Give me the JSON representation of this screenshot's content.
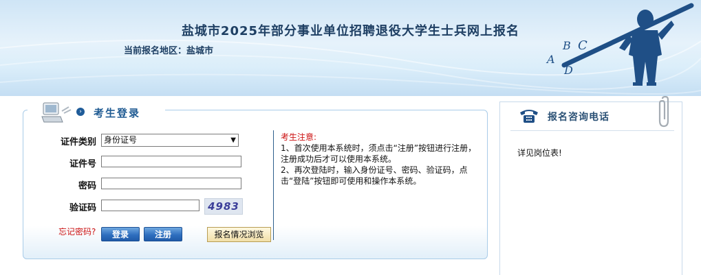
{
  "header": {
    "title": "盐城市2025年部分事业单位招聘退役大学生士兵网上报名",
    "region_label": "当前报名地区：",
    "region_value": "盐城市",
    "banner_letters": [
      "A",
      "B",
      "C",
      "D"
    ]
  },
  "login": {
    "title": "考生登录",
    "fields": {
      "id_type_label": "证件类别",
      "id_type_value": "身份证号",
      "id_number_label": "证件号",
      "password_label": "密码",
      "captcha_label": "验证码",
      "captcha_text": "4983"
    },
    "forgot_password": "忘记密码?",
    "login_button": "登录",
    "register_button": "注册",
    "browse_button": "报名情况浏览",
    "notice": {
      "title": "考生注意:",
      "item1": "1、首次使用本系统时，须点击“注册”按钮进行注册，注册成功后才可以使用本系统。",
      "item2": "2、再次登陆时，输入身份证号、密码、验证码，点击“登陆”按钮即可使用和操作本系统。"
    }
  },
  "contact": {
    "title": "报名咨询电话",
    "text": "详见岗位表!"
  },
  "colors": {
    "accent": "#1e5a92",
    "notice_red": "#cc1111",
    "button_blue": "#2f6fbf"
  }
}
